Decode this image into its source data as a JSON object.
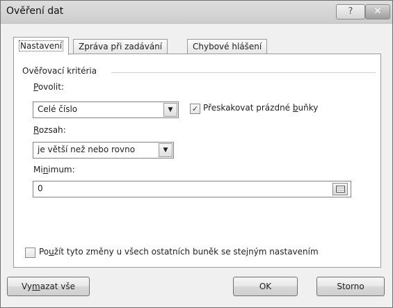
{
  "dialog": {
    "title": "Ověření dat",
    "help_glyph": "?",
    "close_glyph": "✕"
  },
  "tabs": [
    {
      "label": "Nastavení"
    },
    {
      "label": "Zpráva při zadávání"
    },
    {
      "label": "Chybové hlášení"
    }
  ],
  "settings": {
    "criteria_label": "Ověřovací kritéria",
    "allow": {
      "label_pre": "",
      "label_key": "P",
      "label_post": "ovolit:",
      "value": "Celé číslo"
    },
    "ignore_blank": {
      "label_pre": "Přeskakovat prázdné ",
      "label_key": "b",
      "label_post": "uňky",
      "checked": true
    },
    "data": {
      "label_pre": "",
      "label_key": "R",
      "label_post": "ozsah:",
      "value": "je větší než nebo rovno"
    },
    "minimum": {
      "label_pre": "Mi",
      "label_key": "n",
      "label_post": "imum:",
      "value": "0"
    },
    "apply_all": {
      "label_pre": "Po",
      "label_key": "u",
      "label_post": "žít tyto změny u všech ostatních buněk se stejným nastavením",
      "checked": false
    }
  },
  "buttons": {
    "clear_pre": "Vy",
    "clear_key": "m",
    "clear_post": "azat vše",
    "ok": "OK",
    "cancel": "Storno"
  },
  "icons": {
    "dropdown": "chevron-down-icon",
    "checkmark": "checkmark-icon",
    "range_selector": "range-selector-icon"
  }
}
